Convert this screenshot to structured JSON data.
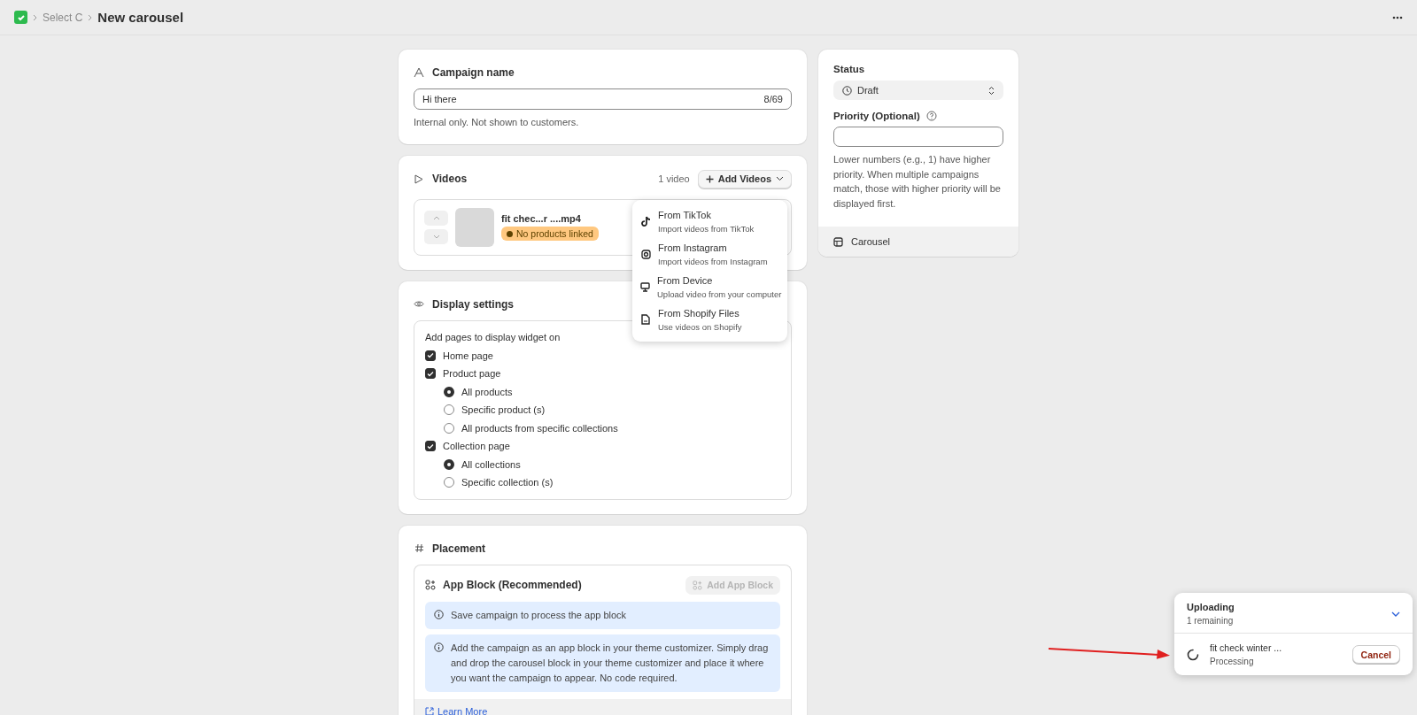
{
  "top_bar": {
    "breadcrumb": [
      {
        "label": "Select C"
      }
    ],
    "title": "New carousel"
  },
  "campaign_name": {
    "title": "Campaign name",
    "field": {
      "value": "Hi there",
      "counter": "8/69"
    },
    "help": "Internal only. Not shown to customers."
  },
  "videos": {
    "title": "Videos",
    "count": "1 video",
    "add_button": "Add Videos",
    "items": [
      {
        "name": "fit chec...r ....mp4",
        "badge": "No products linked"
      }
    ],
    "menu": [
      {
        "kind": "tiktok",
        "title": "From TikTok",
        "subtitle": "Import videos from TikTok"
      },
      {
        "kind": "instagram",
        "title": "From Instagram",
        "subtitle": "Import videos from Instagram"
      },
      {
        "kind": "device",
        "title": "From Device",
        "subtitle": "Upload video from your computer"
      },
      {
        "kind": "files",
        "title": "From Shopify Files",
        "subtitle": "Use videos on Shopify"
      }
    ]
  },
  "display_settings": {
    "title": "Display settings",
    "prompt": "Add pages to display widget on",
    "options": [
      {
        "label": "Home page",
        "checked": true
      },
      {
        "label": "Product page",
        "checked": true,
        "children": [
          {
            "label": "All products",
            "selected": true
          },
          {
            "label": "Specific product (s)",
            "selected": false
          },
          {
            "label": "All products from specific collections",
            "selected": false
          }
        ]
      },
      {
        "label": "Collection page",
        "checked": true,
        "children": [
          {
            "label": "All collections",
            "selected": true
          },
          {
            "label": "Specific collection (s)",
            "selected": false
          }
        ]
      }
    ]
  },
  "placement": {
    "title": "Placement",
    "app_block": {
      "title": "App Block (Recommended)",
      "button": {
        "label": "Add App Block",
        "disabled": true
      }
    },
    "notices": [
      "Save campaign to process the app block",
      "Add the campaign as an app block in your theme customizer. Simply drag and drop the carousel block in your theme customizer and place it where you want the campaign to appear. No code required."
    ],
    "link": "Learn More"
  },
  "sidebar": {
    "status": {
      "label": "Status",
      "value": "Draft"
    },
    "priority": {
      "label": "Priority (Optional)",
      "help": "Lower numbers (e.g., 1) have higher priority. When multiple campaigns match, those with higher priority will be displayed first."
    },
    "footer": "Carousel"
  },
  "upload_toast": {
    "title": "Uploading",
    "remaining": "1 remaining",
    "items": [
      {
        "name": "fit check winter ...",
        "status": "Processing",
        "button": "Cancel"
      }
    ]
  }
}
